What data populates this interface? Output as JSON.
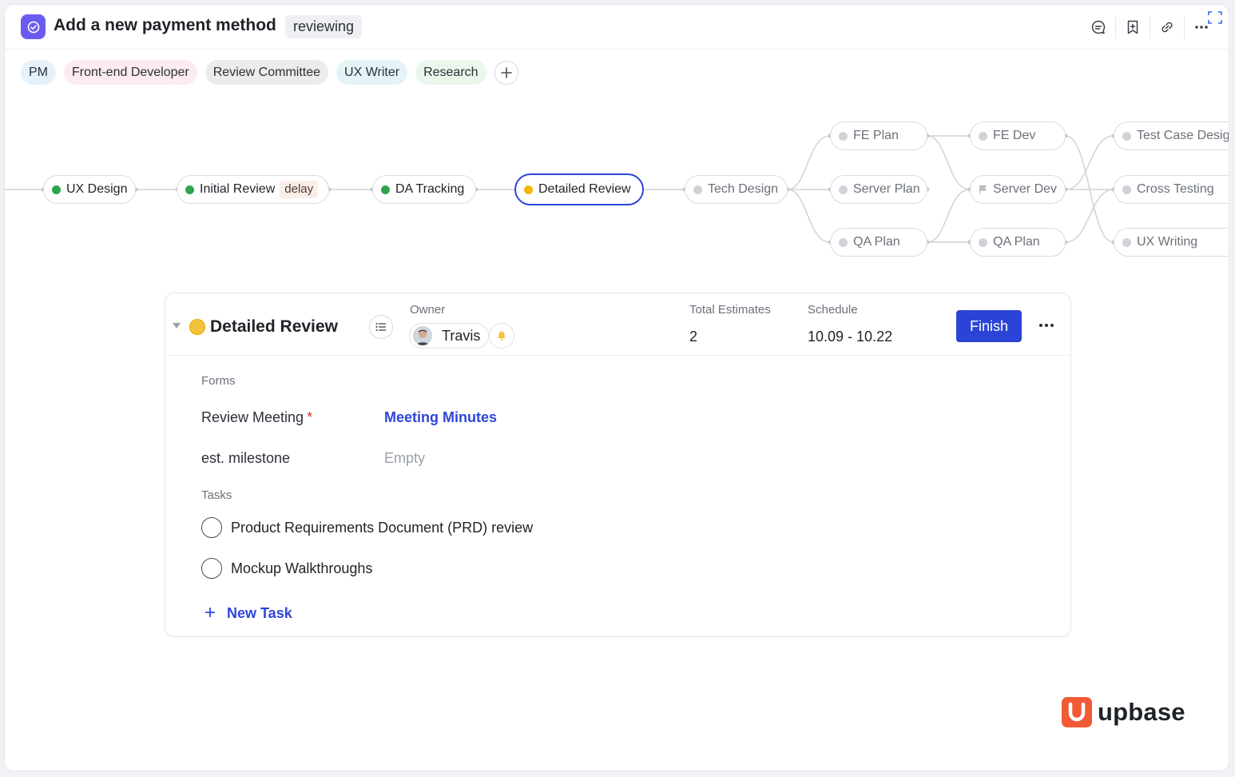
{
  "header": {
    "title": "Add a new payment method",
    "status": "reviewing",
    "actions": [
      "comment-icon",
      "bookmark-icon",
      "link-icon",
      "more-icon"
    ]
  },
  "roles": [
    "PM",
    "Front-end Developer",
    "Review Committee",
    "UX Writer",
    "Research"
  ],
  "workflow": {
    "nodes": {
      "ux_design": {
        "label": "UX Design",
        "status": "done"
      },
      "initial_review": {
        "label": "Initial Review",
        "status": "done",
        "tag": "delay"
      },
      "da_tracking": {
        "label": "DA Tracking",
        "status": "done"
      },
      "detailed_review": {
        "label": "Detailed Review",
        "status": "in-progress"
      },
      "tech_design": {
        "label": "Tech Design",
        "status": "pending"
      },
      "fe_plan": {
        "label": "FE Plan",
        "status": "pending"
      },
      "server_plan": {
        "label": "Server Plan",
        "status": "pending"
      },
      "qa_plan_1": {
        "label": "QA Plan",
        "status": "pending"
      },
      "fe_dev": {
        "label": "FE Dev",
        "status": "pending"
      },
      "server_dev": {
        "label": "Server Dev",
        "status": "pending"
      },
      "qa_plan_2": {
        "label": "QA Plan",
        "status": "pending"
      },
      "test_case": {
        "label": "Test Case Desig",
        "status": "pending"
      },
      "cross_testing": {
        "label": "Cross Testing",
        "status": "pending"
      },
      "ux_writing": {
        "label": "UX Writing",
        "status": "pending"
      }
    }
  },
  "card": {
    "title": "Detailed Review",
    "owner_label": "Owner",
    "owner_name": "Travis",
    "estimates_label": "Total Estimates",
    "estimates_value": "2",
    "schedule_label": "Schedule",
    "schedule_value": "10.09 - 10.22",
    "finish_label": "Finish",
    "forms_label": "Forms",
    "fields": {
      "review_meeting": {
        "label": "Review Meeting",
        "required_mark": "*",
        "value": "Meeting Minutes"
      },
      "milestone": {
        "label": "est. milestone",
        "value": "Empty"
      }
    },
    "tasks_label": "Tasks",
    "tasks": [
      "Product Requirements Document (PRD) review",
      "Mockup Walkthroughs"
    ],
    "new_task_label": "New Task"
  },
  "brand": {
    "name": "upbase",
    "color": "#f15a35"
  },
  "colors": {
    "accent": "#2b44d7",
    "done": "#2ea44f",
    "in_progress": "#f5b700",
    "pending": "#cfd2d7"
  }
}
